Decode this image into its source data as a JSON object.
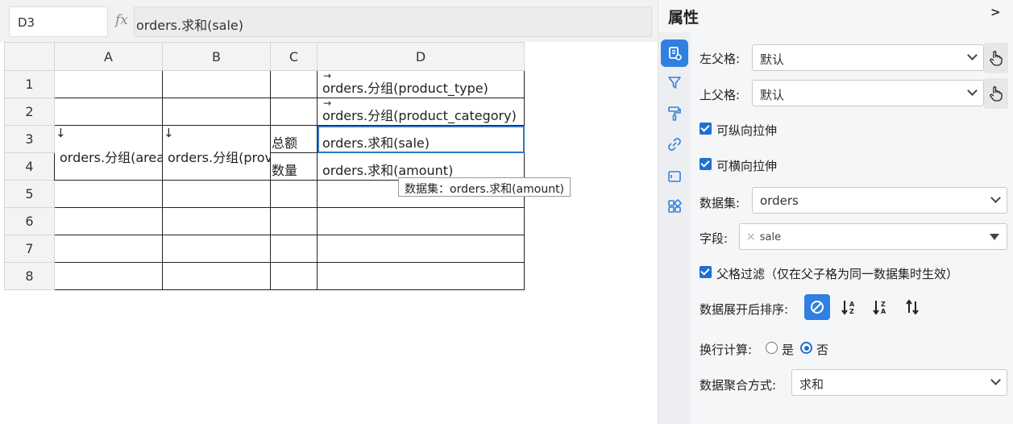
{
  "formula_bar": {
    "cell_ref": "D3",
    "fx_label": "fx",
    "formula": "orders.求和(sale)"
  },
  "sheet": {
    "columns": [
      "A",
      "B",
      "C",
      "D"
    ],
    "rows": [
      "1",
      "2",
      "3",
      "4",
      "5",
      "6",
      "7",
      "8"
    ],
    "cells": {
      "D1": "orders.分组(product_type)",
      "D2": "orders.分组(product_category)",
      "A3": "orders.分组(area)",
      "B3": "orders.分组(province)",
      "C3": "总额",
      "D3": "orders.求和(sale)",
      "C4": "数量",
      "D4": "orders.求和(amount)"
    },
    "arrow_right": "→",
    "arrow_down": "↓",
    "tooltip": "数据集：orders.求和(amount)"
  },
  "panel": {
    "title": "属性",
    "collapse": ">",
    "left_parent_label": "左父格:",
    "left_parent_value": "默认",
    "top_parent_label": "上父格:",
    "top_parent_value": "默认",
    "vertical_stretch": "可纵向拉伸",
    "horizontal_stretch": "可横向拉伸",
    "dataset_label": "数据集:",
    "dataset_value": "orders",
    "field_label": "字段:",
    "field_tag": "sale",
    "parent_filter": "父格过滤（仅在父子格为同一数据集时生效）",
    "sort_label": "数据展开后排序:",
    "sort_options": [
      "none",
      "asc-az",
      "desc-za",
      "custom"
    ],
    "sort_selected": "none",
    "line_calc_label": "换行计算:",
    "line_calc_yes": "是",
    "line_calc_no": "否",
    "line_calc_selected": "否",
    "aggregate_label": "数据聚合方式:",
    "aggregate_value": "求和"
  },
  "colors": {
    "accent": "#2f80e0",
    "checkbox": "#1f6fd1",
    "selection_border": "#2f76c6"
  }
}
